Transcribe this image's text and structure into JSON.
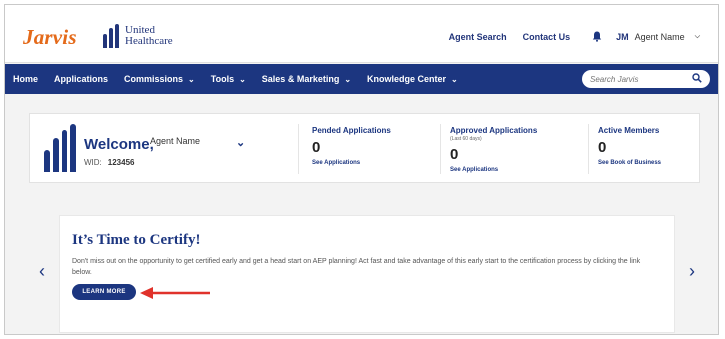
{
  "header": {
    "logo_text": "Jarvis",
    "partner_logo_line1": "United",
    "partner_logo_line2": "Healthcare",
    "agent_search_label": "Agent Search",
    "contact_us_label": "Contact Us",
    "user_initials": "JM",
    "user_name": "Agent Name",
    "bell_icon": "bell-icon"
  },
  "nav": {
    "items": [
      {
        "label": "Home"
      },
      {
        "label": "Applications"
      },
      {
        "label": "Commissions"
      },
      {
        "label": "Tools"
      },
      {
        "label": "Sales & Marketing"
      },
      {
        "label": "Knowledge Center"
      }
    ],
    "search_placeholder": "Search Jarvis"
  },
  "welcome": {
    "greeting": "Welcome,",
    "agent_name": "Agent Name",
    "wid_label": "WID:",
    "wid_value": "123456",
    "stats": [
      {
        "label": "Pended Applications",
        "sub": "",
        "value": "0",
        "link": "See Applications"
      },
      {
        "label": "Approved Applications",
        "sub": "(Last 60 days)",
        "value": "0",
        "link": "See Applications"
      },
      {
        "label": "Active Members",
        "sub": "",
        "value": "0",
        "link": "See Book of Business"
      }
    ]
  },
  "promo": {
    "title": "It’s Time to Certify!",
    "body": "Don't miss out on the opportunity to get certified early and get a head start on AEP planning! Act fast and take advantage of this early start to the certification process by clicking the link below.",
    "button_label": "LEARN MORE"
  },
  "colors": {
    "brand_navy": "#1c3680",
    "jarvis_orange": "#e46a1a",
    "annotation_red": "#e0322b"
  }
}
